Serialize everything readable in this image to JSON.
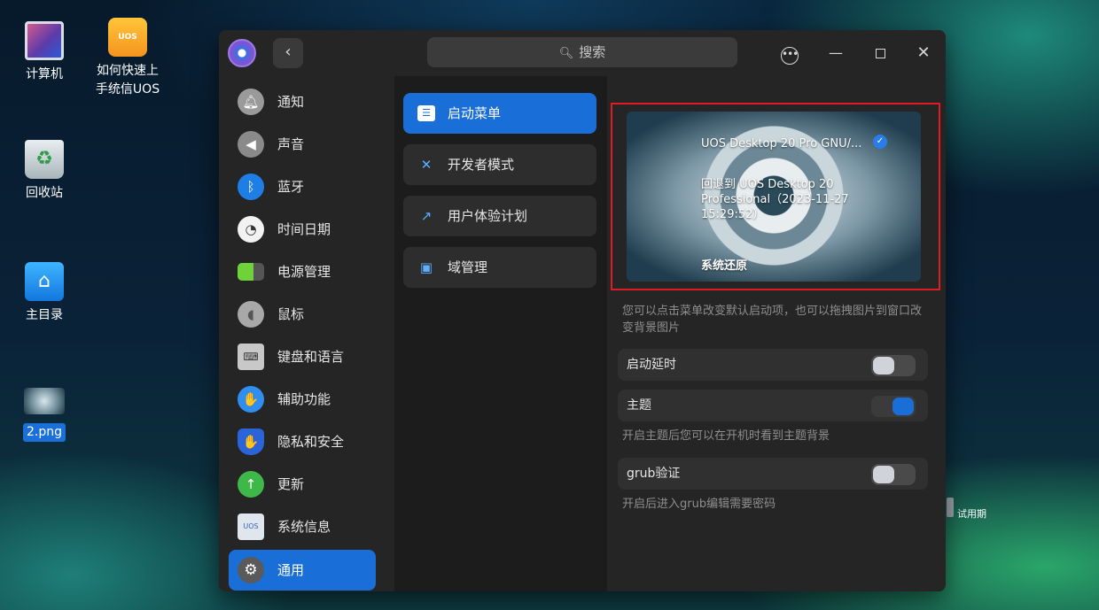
{
  "desktop": {
    "icons": [
      {
        "label": "计算机"
      },
      {
        "label": "如何快速上手统信UOS",
        "badge": "UOS"
      },
      {
        "label": "回收站"
      },
      {
        "label": "主目录"
      },
      {
        "label": "2.png"
      }
    ],
    "trial_text": "试用期"
  },
  "window": {
    "search_placeholder": "搜索",
    "nav_items": [
      {
        "label": "通知",
        "icon": "bell-icon"
      },
      {
        "label": "声音",
        "icon": "speaker-icon"
      },
      {
        "label": "蓝牙",
        "icon": "bluetooth-icon"
      },
      {
        "label": "时间日期",
        "icon": "clock-icon"
      },
      {
        "label": "电源管理",
        "icon": "battery-icon"
      },
      {
        "label": "鼠标",
        "icon": "mouse-icon"
      },
      {
        "label": "键盘和语言",
        "icon": "keyboard-icon"
      },
      {
        "label": "辅助功能",
        "icon": "accessibility-icon"
      },
      {
        "label": "隐私和安全",
        "icon": "shield-icon"
      },
      {
        "label": "更新",
        "icon": "update-icon"
      },
      {
        "label": "系统信息",
        "icon": "system-info-icon"
      },
      {
        "label": "通用",
        "icon": "gear-icon",
        "active": true
      }
    ],
    "sub_items": [
      {
        "label": "启动菜单",
        "icon": "boot-menu-icon",
        "active": true
      },
      {
        "label": "开发者模式",
        "icon": "tools-icon"
      },
      {
        "label": "用户体验计划",
        "icon": "chart-icon"
      },
      {
        "label": "域管理",
        "icon": "domain-icon"
      }
    ],
    "boot_menu": {
      "entries": [
        "UOS Desktop 20 Pro GNU/...",
        "回退到 UOS Desktop 20 Professional（2023-11-27 15:29:52）",
        "系统还原"
      ],
      "default_index": 0
    },
    "boot_hint": "您可以点击菜单改变默认启动项，也可以拖拽图片到窗口改变背景图片",
    "settings": {
      "boot_delay": {
        "label": "启动延时",
        "enabled": false
      },
      "theme": {
        "label": "主题",
        "enabled": true,
        "hint": "开启主题后您可以在开机时看到主题背景"
      },
      "grub_auth": {
        "label": "grub验证",
        "enabled": false,
        "hint": "开启后进入grub编辑需要密码"
      }
    }
  }
}
